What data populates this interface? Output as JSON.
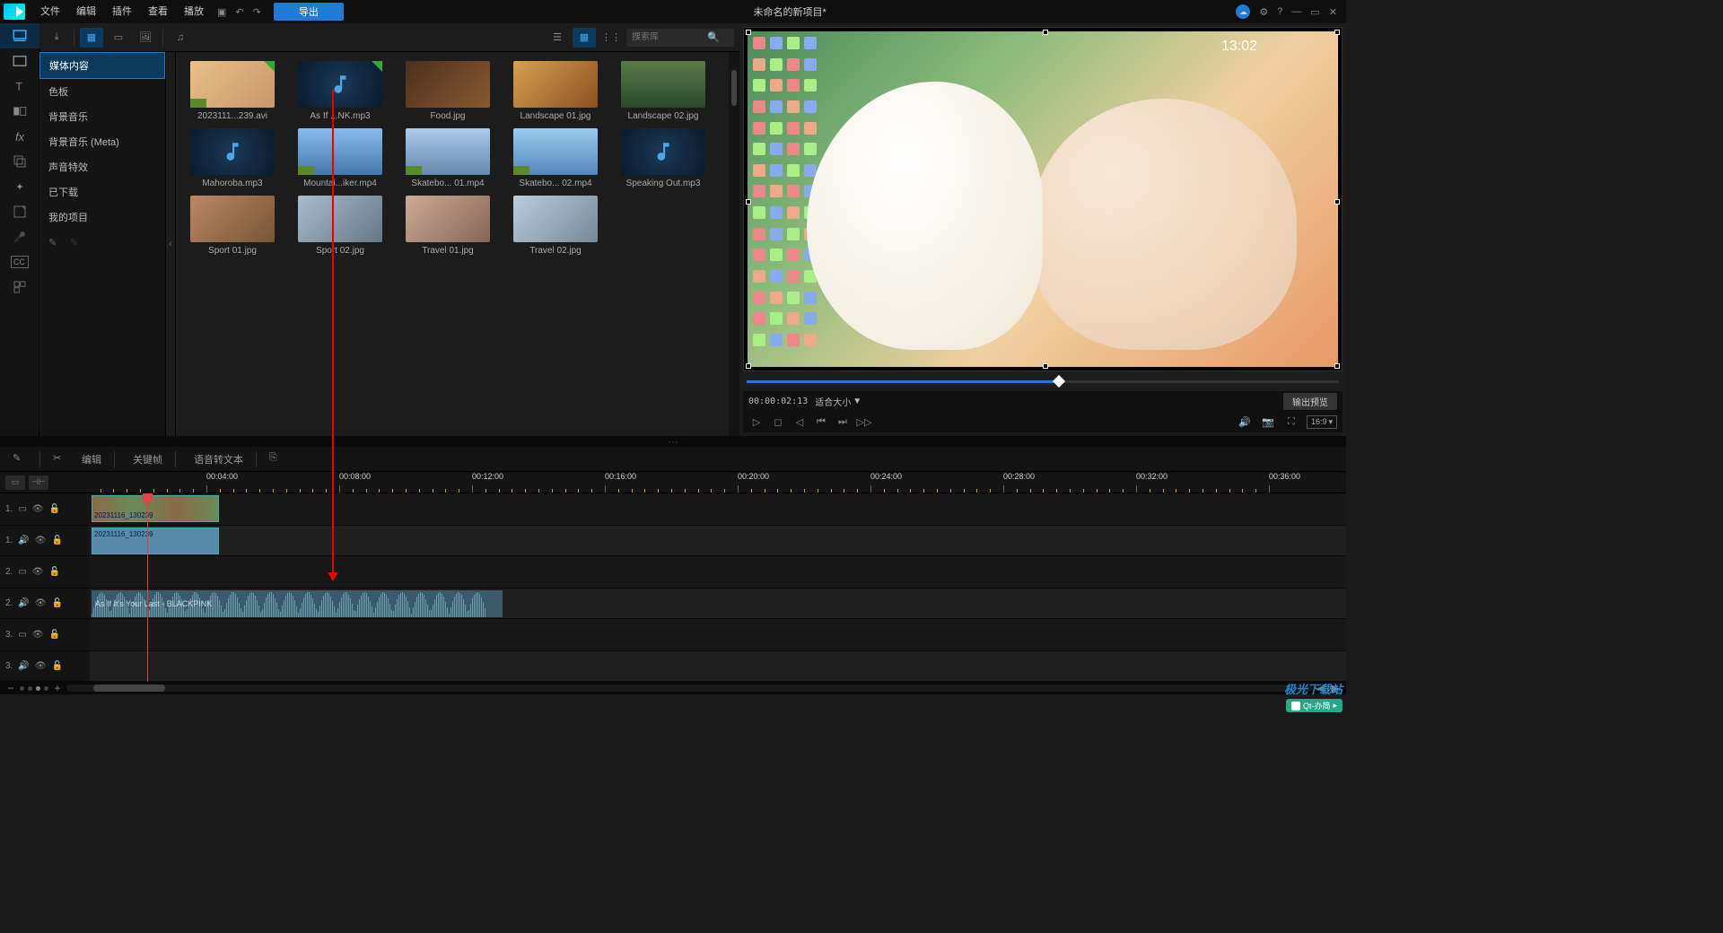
{
  "titlebar": {
    "menus": [
      "文件",
      "编辑",
      "插件",
      "查看",
      "播放"
    ],
    "export": "导出",
    "project_title": "未命名的新项目*"
  },
  "rail": {
    "active_index": 0
  },
  "media_panel": {
    "search_placeholder": "搜索库",
    "categories": [
      "媒体内容",
      "色板",
      "背景音乐",
      "背景音乐 (Meta)",
      "声音特效",
      "已下载",
      "我的项目"
    ],
    "active_category": 0,
    "items": [
      {
        "name": "2023111...239.avi",
        "type": "video",
        "cls": "t1",
        "check": true,
        "vid": true
      },
      {
        "name": "As If ...NK.mp3",
        "type": "audio",
        "check": true
      },
      {
        "name": "Food.jpg",
        "type": "image",
        "cls": "t2"
      },
      {
        "name": "Landscape 01.jpg",
        "type": "image",
        "cls": "t3"
      },
      {
        "name": "Landscape 02.jpg",
        "type": "image",
        "cls": "t4"
      },
      {
        "name": "Mahoroba.mp3",
        "type": "audio"
      },
      {
        "name": "Mountai...iker.mp4",
        "type": "video",
        "cls": "t5",
        "vid": true
      },
      {
        "name": "Skatebo... 01.mp4",
        "type": "video",
        "cls": "t6",
        "vid": true
      },
      {
        "name": "Skatebo... 02.mp4",
        "type": "video",
        "cls": "t7",
        "vid": true
      },
      {
        "name": "Speaking Out.mp3",
        "type": "audio"
      },
      {
        "name": "Sport 01.jpg",
        "type": "image",
        "cls": "t8"
      },
      {
        "name": "Sport 02.jpg",
        "type": "image",
        "cls": "t9"
      },
      {
        "name": "Travel 01.jpg",
        "type": "image",
        "cls": "t10"
      },
      {
        "name": "Travel 02.jpg",
        "type": "image",
        "cls": "t11"
      }
    ]
  },
  "preview": {
    "clock": "13:02",
    "timecode": "00:00:02:13",
    "zoom_mode": "适合大小",
    "output_preview": "输出预览",
    "aspect": "16:9"
  },
  "mid_toolbar": {
    "edit": "编辑",
    "keyframe": "关键帧",
    "speech_to_text": "语音转文本"
  },
  "timeline": {
    "ruler": [
      "00:04:00",
      "00:08:00",
      "00:12:00",
      "00:16:00",
      "00:20:00",
      "00:24:00",
      "00:28:00",
      "00:32:00",
      "00:36:00"
    ],
    "tracks": [
      {
        "label": "1.",
        "type": "video"
      },
      {
        "label": "1.",
        "type": "audio"
      },
      {
        "label": "2.",
        "type": "video"
      },
      {
        "label": "2.",
        "type": "audio"
      },
      {
        "label": "3.",
        "type": "video"
      },
      {
        "label": "3.",
        "type": "audio"
      }
    ],
    "clip1_label": "20231116_130239",
    "clip2_label": "20231116_130239",
    "clip3_label": "As If It's Your Last - BLACKPINK"
  },
  "watermark": {
    "brand": "极光下载站",
    "tag": "Qt-办简"
  }
}
